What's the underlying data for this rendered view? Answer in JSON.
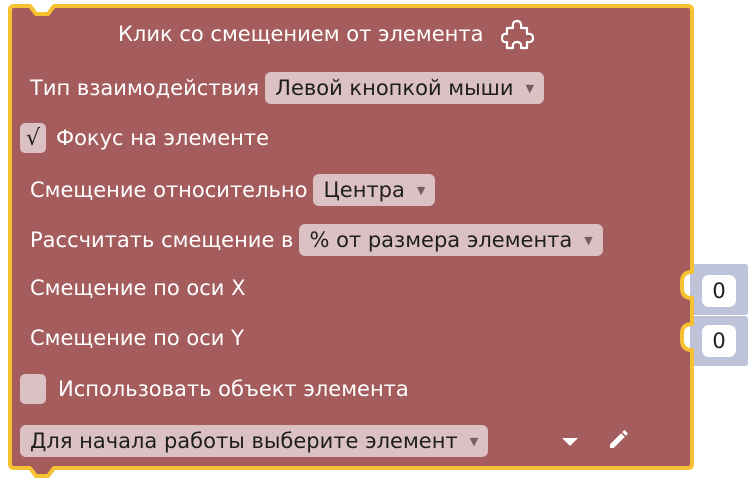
{
  "block": {
    "title": "Клик со смещением от элемента",
    "title_icon": "puzzle-icon",
    "colors": {
      "body": "#a55c5d",
      "outline": "#f6c234",
      "field": "#dbc1c3",
      "value_socket": "#bfc3d9"
    },
    "interaction": {
      "label": "Тип взаимодействия",
      "value": "Левой кнопкой мыши"
    },
    "focus": {
      "label": "Фокус на элементе",
      "checked": true,
      "mark": "√"
    },
    "offset_relative": {
      "label": "Смещение относительно",
      "value": "Центра"
    },
    "calc_offset": {
      "label": "Рассчитать смещение в",
      "value": "% от размера элемента"
    },
    "offset_x": {
      "label": "Смещение по оси X",
      "value": "0"
    },
    "offset_y": {
      "label": "Смещение по оси Y",
      "value": "0"
    },
    "use_object": {
      "label": "Использовать объект элемента",
      "checked": false
    },
    "element_select": {
      "value": "Для начала работы выберите элемент"
    }
  }
}
